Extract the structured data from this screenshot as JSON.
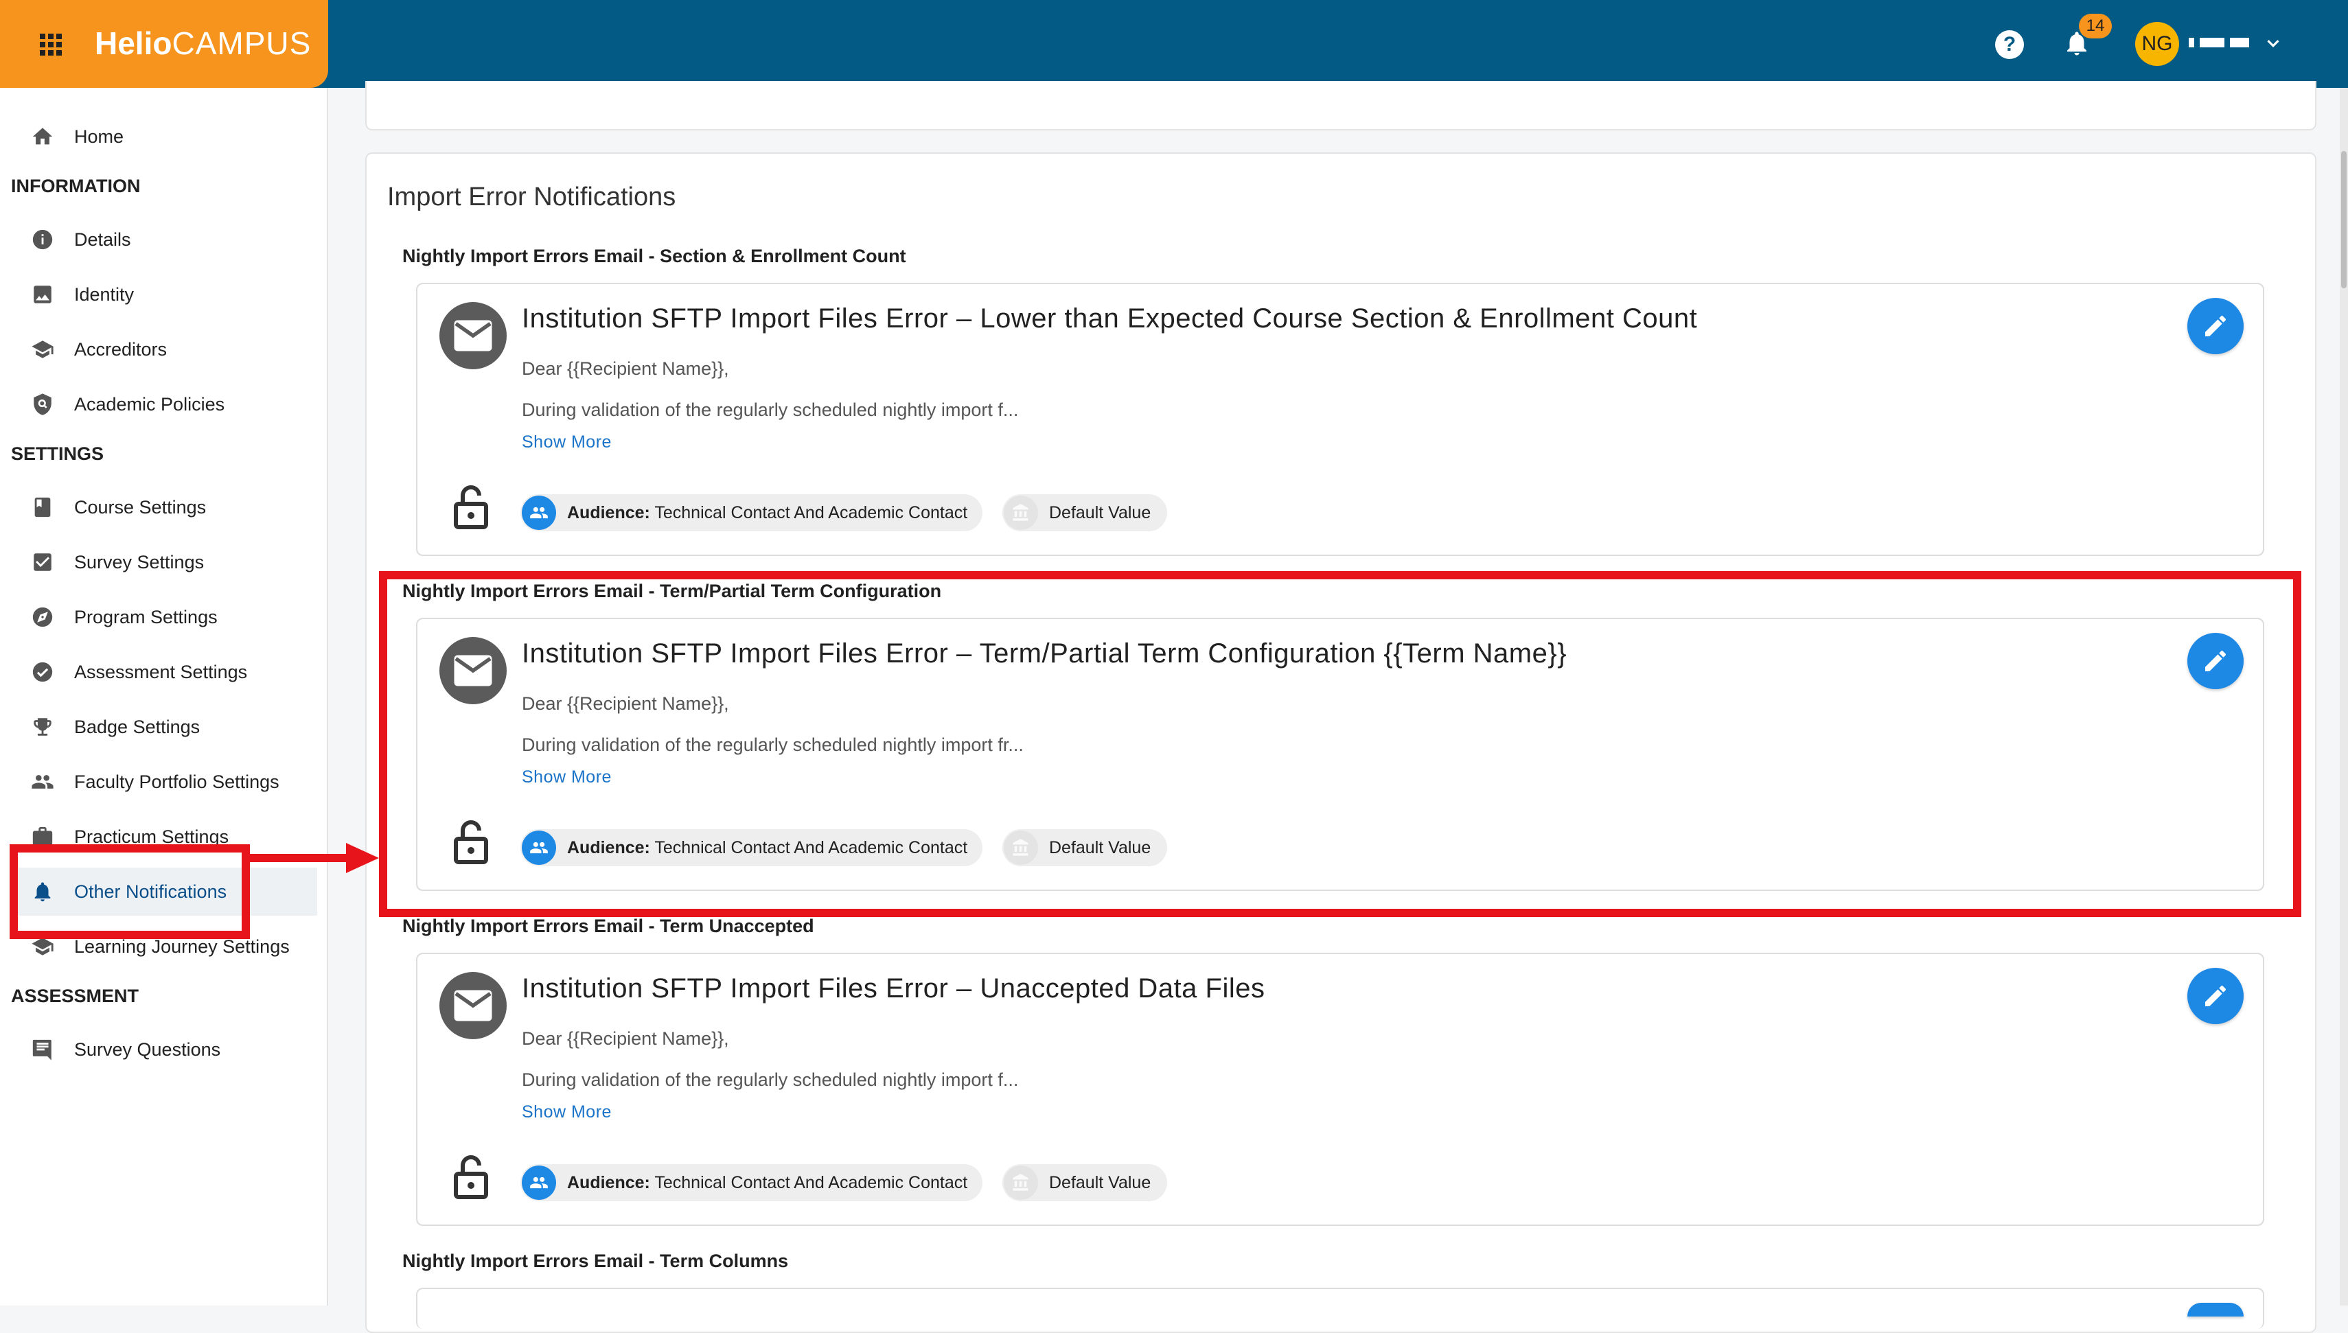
{
  "brand": {
    "logo_bold": "Helio",
    "logo_light": "CAMPUS"
  },
  "topbar": {
    "notification_count": "14",
    "avatar_initials": "NG"
  },
  "sidebar": {
    "home": "Home",
    "sections": [
      {
        "heading": "INFORMATION",
        "items": [
          "Details",
          "Identity",
          "Accreditors",
          "Academic Policies"
        ]
      },
      {
        "heading": "SETTINGS",
        "items": [
          "Course Settings",
          "Survey Settings",
          "Program Settings",
          "Assessment Settings",
          "Badge Settings",
          "Faculty Portfolio Settings",
          "Practicum Settings",
          "Other Notifications",
          "Learning Journey Settings"
        ]
      },
      {
        "heading": "ASSESSMENT",
        "items": [
          "Survey Questions"
        ]
      }
    ],
    "active_item": "Other Notifications"
  },
  "main": {
    "section_title": "Import Error Notifications",
    "groups": [
      {
        "heading": "Nightly Import Errors Email - Section & Enrollment Count",
        "title": "Institution SFTP Import Files Error – Lower than Expected Course Section & Enrollment Count",
        "greeting": "Dear {{Recipient Name}},",
        "preview": "During validation of the regularly scheduled nightly import f...",
        "show_more": "Show More",
        "audience_label": "Audience:",
        "audience_value": "Technical Contact And Academic Contact",
        "default_label": "Default Value"
      },
      {
        "heading": "Nightly Import Errors Email - Term/Partial Term Configuration",
        "title": "Institution SFTP Import Files Error – Term/Partial Term Configuration {{Term Name}}",
        "greeting": "Dear {{Recipient Name}},",
        "preview": "During validation of the regularly scheduled nightly import fr...",
        "show_more": "Show More",
        "audience_label": "Audience:",
        "audience_value": "Technical Contact And Academic Contact",
        "default_label": "Default Value"
      },
      {
        "heading": "Nightly Import Errors Email - Term Unaccepted",
        "title": "Institution SFTP Import Files Error – Unaccepted Data Files",
        "greeting": "Dear {{Recipient Name}},",
        "preview": "During validation of the regularly scheduled nightly import f...",
        "show_more": "Show More",
        "audience_label": "Audience:",
        "audience_value": "Technical Contact And Academic Contact",
        "default_label": "Default Value"
      },
      {
        "heading": "Nightly Import Errors Email - Term Columns"
      }
    ]
  },
  "colors": {
    "topbar": "#035a85",
    "brand": "#f7941d",
    "accent": "#1e88e5",
    "annotation": "#e8141b"
  }
}
